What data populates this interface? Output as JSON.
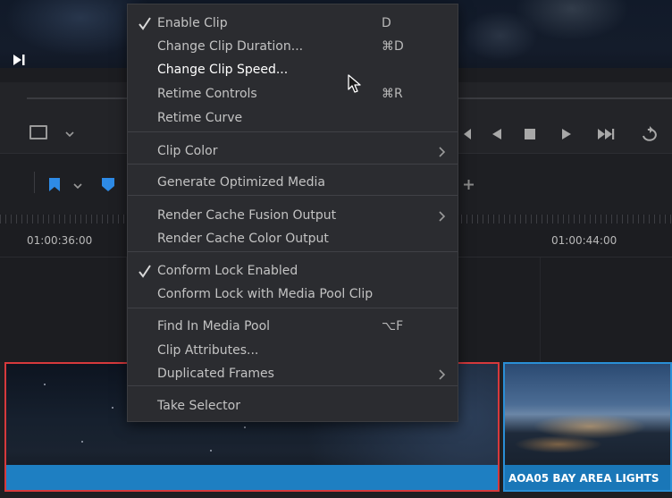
{
  "timeline": {
    "timecode_left": "01:00:36:00",
    "timecode_right": "01:00:44:00",
    "clip_right_name": "AOA05 BAY AREA LIGHTS"
  },
  "icons": {
    "viewer": [
      "play-start-icon",
      "viewer-mode-icon",
      "chevron-down-icon"
    ],
    "transport": [
      "prev-frame-icon",
      "play-reverse-icon",
      "stop-icon",
      "play-icon",
      "next-clip-icon",
      "loop-icon"
    ],
    "toolbar": [
      "flag-marker-icon",
      "chevron-down-icon",
      "marker-icon",
      "add-icon"
    ]
  },
  "colors": {
    "selected_clip_border": "#d6393c",
    "clip_bar": "#1e7fc2",
    "menu_bg": "#2b2c30"
  },
  "menu": {
    "items": [
      {
        "label": "Enable Clip",
        "shortcut": "D",
        "checked": true,
        "submenu": false
      },
      {
        "label": "Change Clip Duration...",
        "shortcut": "⌘D",
        "checked": false,
        "submenu": false
      },
      {
        "label": "Change Clip Speed...",
        "shortcut": "",
        "checked": false,
        "submenu": false,
        "hovered": true
      },
      {
        "label": "Retime Controls",
        "shortcut": "⌘R",
        "checked": false,
        "submenu": false
      },
      {
        "label": "Retime Curve",
        "shortcut": "",
        "checked": false,
        "submenu": false
      },
      {
        "label": "Clip Color",
        "shortcut": "",
        "checked": false,
        "submenu": true
      },
      {
        "label": "Generate Optimized Media",
        "shortcut": "",
        "checked": false,
        "submenu": false
      },
      {
        "label": "Render Cache Fusion Output",
        "shortcut": "",
        "checked": false,
        "submenu": true
      },
      {
        "label": "Render Cache Color Output",
        "shortcut": "",
        "checked": false,
        "submenu": false
      },
      {
        "label": "Conform Lock Enabled",
        "shortcut": "",
        "checked": true,
        "submenu": false
      },
      {
        "label": "Conform Lock with Media Pool Clip",
        "shortcut": "",
        "checked": false,
        "submenu": false
      },
      {
        "label": "Find In Media Pool",
        "shortcut": "⌥F",
        "checked": false,
        "submenu": false
      },
      {
        "label": "Clip Attributes...",
        "shortcut": "",
        "checked": false,
        "submenu": false
      },
      {
        "label": "Duplicated Frames",
        "shortcut": "",
        "checked": false,
        "submenu": true
      },
      {
        "label": "Take Selector",
        "shortcut": "",
        "checked": false,
        "submenu": false
      }
    ]
  }
}
